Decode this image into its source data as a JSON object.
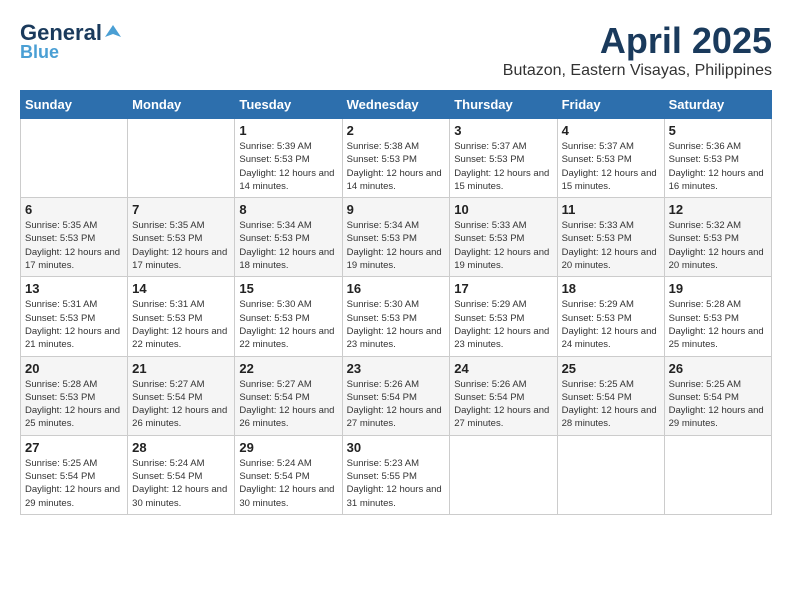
{
  "header": {
    "logo_general": "General",
    "logo_blue": "Blue",
    "month_title": "April 2025",
    "location": "Butazon, Eastern Visayas, Philippines"
  },
  "calendar": {
    "days_of_week": [
      "Sunday",
      "Monday",
      "Tuesday",
      "Wednesday",
      "Thursday",
      "Friday",
      "Saturday"
    ],
    "weeks": [
      [
        {
          "day": null,
          "sunrise": null,
          "sunset": null,
          "daylight": null
        },
        {
          "day": null,
          "sunrise": null,
          "sunset": null,
          "daylight": null
        },
        {
          "day": "1",
          "sunrise": "Sunrise: 5:39 AM",
          "sunset": "Sunset: 5:53 PM",
          "daylight": "Daylight: 12 hours and 14 minutes."
        },
        {
          "day": "2",
          "sunrise": "Sunrise: 5:38 AM",
          "sunset": "Sunset: 5:53 PM",
          "daylight": "Daylight: 12 hours and 14 minutes."
        },
        {
          "day": "3",
          "sunrise": "Sunrise: 5:37 AM",
          "sunset": "Sunset: 5:53 PM",
          "daylight": "Daylight: 12 hours and 15 minutes."
        },
        {
          "day": "4",
          "sunrise": "Sunrise: 5:37 AM",
          "sunset": "Sunset: 5:53 PM",
          "daylight": "Daylight: 12 hours and 15 minutes."
        },
        {
          "day": "5",
          "sunrise": "Sunrise: 5:36 AM",
          "sunset": "Sunset: 5:53 PM",
          "daylight": "Daylight: 12 hours and 16 minutes."
        }
      ],
      [
        {
          "day": "6",
          "sunrise": "Sunrise: 5:35 AM",
          "sunset": "Sunset: 5:53 PM",
          "daylight": "Daylight: 12 hours and 17 minutes."
        },
        {
          "day": "7",
          "sunrise": "Sunrise: 5:35 AM",
          "sunset": "Sunset: 5:53 PM",
          "daylight": "Daylight: 12 hours and 17 minutes."
        },
        {
          "day": "8",
          "sunrise": "Sunrise: 5:34 AM",
          "sunset": "Sunset: 5:53 PM",
          "daylight": "Daylight: 12 hours and 18 minutes."
        },
        {
          "day": "9",
          "sunrise": "Sunrise: 5:34 AM",
          "sunset": "Sunset: 5:53 PM",
          "daylight": "Daylight: 12 hours and 19 minutes."
        },
        {
          "day": "10",
          "sunrise": "Sunrise: 5:33 AM",
          "sunset": "Sunset: 5:53 PM",
          "daylight": "Daylight: 12 hours and 19 minutes."
        },
        {
          "day": "11",
          "sunrise": "Sunrise: 5:33 AM",
          "sunset": "Sunset: 5:53 PM",
          "daylight": "Daylight: 12 hours and 20 minutes."
        },
        {
          "day": "12",
          "sunrise": "Sunrise: 5:32 AM",
          "sunset": "Sunset: 5:53 PM",
          "daylight": "Daylight: 12 hours and 20 minutes."
        }
      ],
      [
        {
          "day": "13",
          "sunrise": "Sunrise: 5:31 AM",
          "sunset": "Sunset: 5:53 PM",
          "daylight": "Daylight: 12 hours and 21 minutes."
        },
        {
          "day": "14",
          "sunrise": "Sunrise: 5:31 AM",
          "sunset": "Sunset: 5:53 PM",
          "daylight": "Daylight: 12 hours and 22 minutes."
        },
        {
          "day": "15",
          "sunrise": "Sunrise: 5:30 AM",
          "sunset": "Sunset: 5:53 PM",
          "daylight": "Daylight: 12 hours and 22 minutes."
        },
        {
          "day": "16",
          "sunrise": "Sunrise: 5:30 AM",
          "sunset": "Sunset: 5:53 PM",
          "daylight": "Daylight: 12 hours and 23 minutes."
        },
        {
          "day": "17",
          "sunrise": "Sunrise: 5:29 AM",
          "sunset": "Sunset: 5:53 PM",
          "daylight": "Daylight: 12 hours and 23 minutes."
        },
        {
          "day": "18",
          "sunrise": "Sunrise: 5:29 AM",
          "sunset": "Sunset: 5:53 PM",
          "daylight": "Daylight: 12 hours and 24 minutes."
        },
        {
          "day": "19",
          "sunrise": "Sunrise: 5:28 AM",
          "sunset": "Sunset: 5:53 PM",
          "daylight": "Daylight: 12 hours and 25 minutes."
        }
      ],
      [
        {
          "day": "20",
          "sunrise": "Sunrise: 5:28 AM",
          "sunset": "Sunset: 5:53 PM",
          "daylight": "Daylight: 12 hours and 25 minutes."
        },
        {
          "day": "21",
          "sunrise": "Sunrise: 5:27 AM",
          "sunset": "Sunset: 5:54 PM",
          "daylight": "Daylight: 12 hours and 26 minutes."
        },
        {
          "day": "22",
          "sunrise": "Sunrise: 5:27 AM",
          "sunset": "Sunset: 5:54 PM",
          "daylight": "Daylight: 12 hours and 26 minutes."
        },
        {
          "day": "23",
          "sunrise": "Sunrise: 5:26 AM",
          "sunset": "Sunset: 5:54 PM",
          "daylight": "Daylight: 12 hours and 27 minutes."
        },
        {
          "day": "24",
          "sunrise": "Sunrise: 5:26 AM",
          "sunset": "Sunset: 5:54 PM",
          "daylight": "Daylight: 12 hours and 27 minutes."
        },
        {
          "day": "25",
          "sunrise": "Sunrise: 5:25 AM",
          "sunset": "Sunset: 5:54 PM",
          "daylight": "Daylight: 12 hours and 28 minutes."
        },
        {
          "day": "26",
          "sunrise": "Sunrise: 5:25 AM",
          "sunset": "Sunset: 5:54 PM",
          "daylight": "Daylight: 12 hours and 29 minutes."
        }
      ],
      [
        {
          "day": "27",
          "sunrise": "Sunrise: 5:25 AM",
          "sunset": "Sunset: 5:54 PM",
          "daylight": "Daylight: 12 hours and 29 minutes."
        },
        {
          "day": "28",
          "sunrise": "Sunrise: 5:24 AM",
          "sunset": "Sunset: 5:54 PM",
          "daylight": "Daylight: 12 hours and 30 minutes."
        },
        {
          "day": "29",
          "sunrise": "Sunrise: 5:24 AM",
          "sunset": "Sunset: 5:54 PM",
          "daylight": "Daylight: 12 hours and 30 minutes."
        },
        {
          "day": "30",
          "sunrise": "Sunrise: 5:23 AM",
          "sunset": "Sunset: 5:55 PM",
          "daylight": "Daylight: 12 hours and 31 minutes."
        },
        {
          "day": null,
          "sunrise": null,
          "sunset": null,
          "daylight": null
        },
        {
          "day": null,
          "sunrise": null,
          "sunset": null,
          "daylight": null
        },
        {
          "day": null,
          "sunrise": null,
          "sunset": null,
          "daylight": null
        }
      ]
    ]
  }
}
